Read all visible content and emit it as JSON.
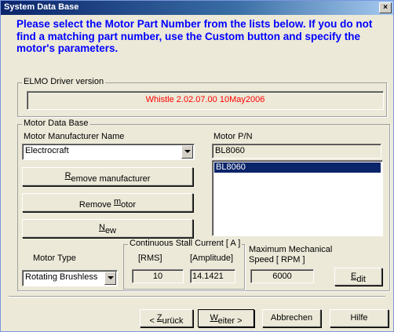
{
  "window": {
    "title": "System Data Base",
    "close_glyph": "×"
  },
  "instruction": "Please select the Motor Part Number from the lists below. If you do not find a matching part number, use the Custom button and specify the motor's parameters.",
  "driver_version": {
    "legend": "ELMO Driver version",
    "value": "Whistle 2.02.07.00 10May2006",
    "value_color": "#ff0000"
  },
  "motor_db": {
    "legend": "Motor Data Base",
    "manufacturer_label": "Motor Manufacturer Name",
    "manufacturer_value": "Electrocraft",
    "pn_label": "Motor P/N",
    "pn_value": "BL8060",
    "pn_list": [
      "BL8060"
    ],
    "remove_manufacturer": {
      "pre": "",
      "key": "R",
      "post": "emove manufacturer"
    },
    "remove_motor": {
      "pre": "Remove ",
      "key": "m",
      "post": "otor"
    },
    "new_btn": {
      "pre": "",
      "key": "N",
      "post": "ew"
    },
    "motor_type_label": "Motor Type",
    "motor_type_value": "Rotating Brushless",
    "stall_legend": "Continuous Stall Current [ A ]",
    "rms_label": "[RMS]",
    "amp_label": "[Amplitude]",
    "rms_value": "10",
    "amp_value": "14.1421",
    "speed_label_1": "Maximum Mechanical",
    "speed_label_2": "Speed  [ RPM ]",
    "speed_value": "6000",
    "edit_btn": {
      "pre": "",
      "key": "E",
      "post": "dit"
    }
  },
  "footer": {
    "back": {
      "pre": "< ",
      "key": "Z",
      "post": "urück"
    },
    "next": {
      "pre": "",
      "key": "W",
      "post": "eiter >"
    },
    "cancel": "Abbrechen",
    "help": "Hilfe"
  },
  "colors": {
    "accent_title": "#0a246a",
    "instruction": "#0000ff",
    "selection": "#0a246a"
  }
}
